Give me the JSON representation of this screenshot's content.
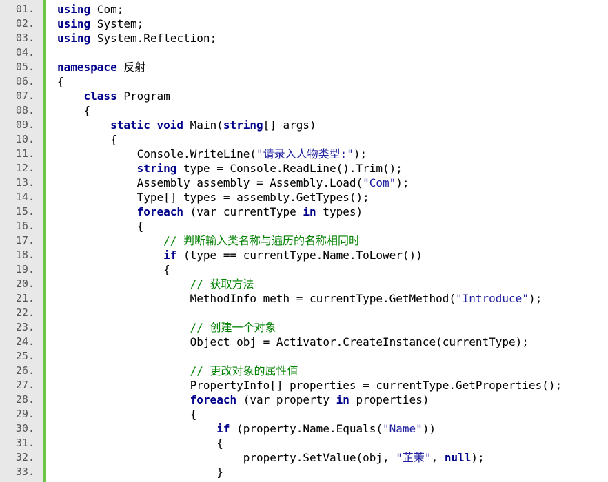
{
  "lines": [
    {
      "n": "01.",
      "segs": [
        {
          "t": "using",
          "c": "kw"
        },
        {
          "t": " Com;"
        }
      ]
    },
    {
      "n": "02.",
      "segs": [
        {
          "t": "using",
          "c": "kw"
        },
        {
          "t": " System;"
        }
      ]
    },
    {
      "n": "03.",
      "segs": [
        {
          "t": "using",
          "c": "kw"
        },
        {
          "t": " System.Reflection;"
        }
      ]
    },
    {
      "n": "04.",
      "segs": []
    },
    {
      "n": "05.",
      "segs": [
        {
          "t": "namespace",
          "c": "kw"
        },
        {
          "t": " 反射"
        }
      ]
    },
    {
      "n": "06.",
      "segs": [
        {
          "t": "{"
        }
      ]
    },
    {
      "n": "07.",
      "segs": [
        {
          "t": "    "
        },
        {
          "t": "class",
          "c": "kw"
        },
        {
          "t": " Program"
        }
      ]
    },
    {
      "n": "08.",
      "segs": [
        {
          "t": "    {"
        }
      ]
    },
    {
      "n": "09.",
      "segs": [
        {
          "t": "        "
        },
        {
          "t": "static",
          "c": "kw"
        },
        {
          "t": " "
        },
        {
          "t": "void",
          "c": "kw"
        },
        {
          "t": " Main("
        },
        {
          "t": "string",
          "c": "kw"
        },
        {
          "t": "[] args)"
        }
      ]
    },
    {
      "n": "10.",
      "segs": [
        {
          "t": "        {"
        }
      ]
    },
    {
      "n": "11.",
      "segs": [
        {
          "t": "            Console.WriteLine("
        },
        {
          "t": "\"请录入人物类型:\"",
          "c": "str"
        },
        {
          "t": ");"
        }
      ]
    },
    {
      "n": "12.",
      "segs": [
        {
          "t": "            "
        },
        {
          "t": "string",
          "c": "kw"
        },
        {
          "t": " type = Console.ReadLine().Trim();"
        }
      ]
    },
    {
      "n": "13.",
      "segs": [
        {
          "t": "            Assembly assembly = Assembly.Load("
        },
        {
          "t": "\"Com\"",
          "c": "str"
        },
        {
          "t": ");"
        }
      ]
    },
    {
      "n": "14.",
      "segs": [
        {
          "t": "            Type[] types = assembly.GetTypes();"
        }
      ]
    },
    {
      "n": "15.",
      "segs": [
        {
          "t": "            "
        },
        {
          "t": "foreach",
          "c": "kw"
        },
        {
          "t": " (var currentType "
        },
        {
          "t": "in",
          "c": "kw"
        },
        {
          "t": " types)"
        }
      ]
    },
    {
      "n": "16.",
      "segs": [
        {
          "t": "            {"
        }
      ]
    },
    {
      "n": "17.",
      "segs": [
        {
          "t": "                "
        },
        {
          "t": "// 判断输入类名称与遍历的名称相同时",
          "c": "cmt"
        }
      ]
    },
    {
      "n": "18.",
      "segs": [
        {
          "t": "                "
        },
        {
          "t": "if",
          "c": "kw"
        },
        {
          "t": " (type == currentType.Name.ToLower())"
        }
      ]
    },
    {
      "n": "19.",
      "segs": [
        {
          "t": "                {"
        }
      ]
    },
    {
      "n": "20.",
      "segs": [
        {
          "t": "                    "
        },
        {
          "t": "// 获取方法",
          "c": "cmt"
        }
      ]
    },
    {
      "n": "21.",
      "segs": [
        {
          "t": "                    MethodInfo meth = currentType.GetMethod("
        },
        {
          "t": "\"Introduce\"",
          "c": "str"
        },
        {
          "t": ");"
        }
      ]
    },
    {
      "n": "22.",
      "segs": []
    },
    {
      "n": "23.",
      "segs": [
        {
          "t": "                    "
        },
        {
          "t": "// 创建一个对象",
          "c": "cmt"
        }
      ]
    },
    {
      "n": "24.",
      "segs": [
        {
          "t": "                    Object obj = Activator.CreateInstance(currentType);"
        }
      ]
    },
    {
      "n": "25.",
      "segs": []
    },
    {
      "n": "26.",
      "segs": [
        {
          "t": "                    "
        },
        {
          "t": "// 更改对象的属性值",
          "c": "cmt"
        }
      ]
    },
    {
      "n": "27.",
      "segs": [
        {
          "t": "                    PropertyInfo[] properties = currentType.GetProperties();"
        }
      ]
    },
    {
      "n": "28.",
      "segs": [
        {
          "t": "                    "
        },
        {
          "t": "foreach",
          "c": "kw"
        },
        {
          "t": " (var property "
        },
        {
          "t": "in",
          "c": "kw"
        },
        {
          "t": " properties)"
        }
      ]
    },
    {
      "n": "29.",
      "segs": [
        {
          "t": "                    {"
        }
      ]
    },
    {
      "n": "30.",
      "segs": [
        {
          "t": "                        "
        },
        {
          "t": "if",
          "c": "kw"
        },
        {
          "t": " (property.Name.Equals("
        },
        {
          "t": "\"Name\"",
          "c": "str"
        },
        {
          "t": "))"
        }
      ]
    },
    {
      "n": "31.",
      "segs": [
        {
          "t": "                        {"
        }
      ]
    },
    {
      "n": "32.",
      "segs": [
        {
          "t": "                            property.SetValue(obj, "
        },
        {
          "t": "\"芷茉\"",
          "c": "str"
        },
        {
          "t": ", "
        },
        {
          "t": "null",
          "c": "kw"
        },
        {
          "t": ");"
        }
      ]
    },
    {
      "n": "33.",
      "segs": [
        {
          "t": "                        }"
        }
      ]
    }
  ]
}
